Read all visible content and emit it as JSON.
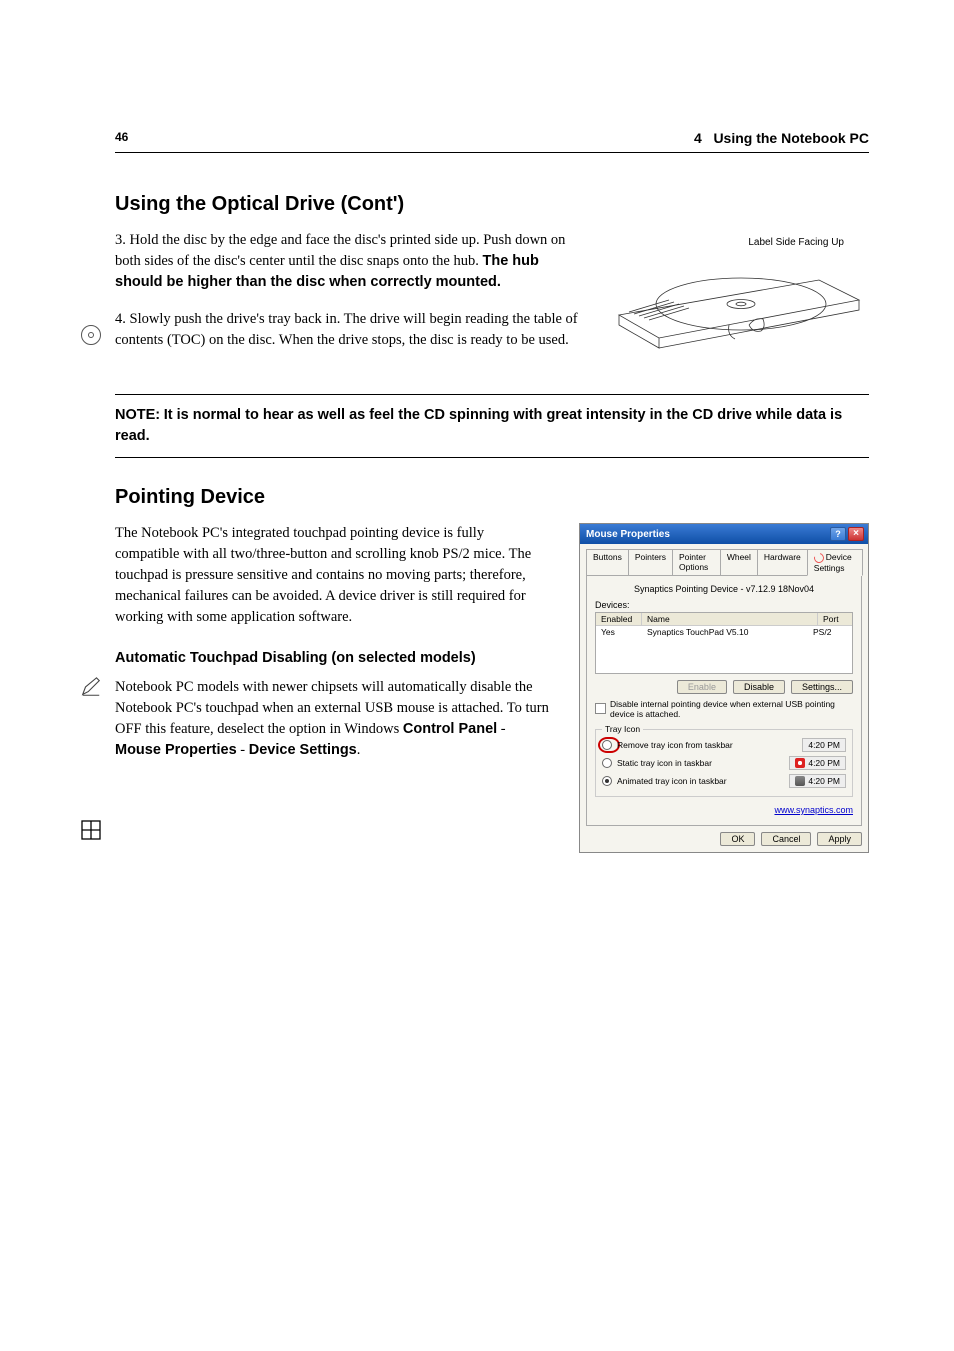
{
  "header": {
    "page_number": "46",
    "chapter_label": "4",
    "chapter_title": "Using the Notebook PC"
  },
  "section1": {
    "title": "Using the Optical Drive (Cont')",
    "p1": "3. Hold the disc by the edge and face the disc's printed side up. Push down on both sides of the disc's center until the disc snaps onto the hub. ",
    "p1_bold": "The hub should be higher than the disc when correctly mounted.",
    "p2": "4. Slowly push the drive's tray back in. The drive will begin reading the table of contents (TOC) on the disc. When the drive stops, the disc is ready to be used.",
    "label_side": "Label Side Facing Up",
    "note_bold": "NOTE:",
    "note_text": " It is normal to hear as well as feel the CD spinning with great intensity in the CD drive while data is read."
  },
  "section2": {
    "title": "Pointing Device",
    "body": "The Notebook PC's integrated touchpad pointing device is fully compatible with all two/three-button and scrolling knob PS/2 mice. The touchpad is pressure sensitive and contains no moving parts; therefore, mechanical failures can be avoided. A device driver is still required for working with some application software.",
    "auto_disable_label": "Automatic Touchpad Disabling (on selected models)",
    "p1": "Notebook PC models with newer chipsets will automatically disable the Notebook PC's touchpad when an external USB mouse is attached. To turn OFF this feature, deselect the option in Windows ",
    "p1_bold1": "Control Panel",
    "p1_sep1": " - ",
    "p1_bold2": "Mouse Properties",
    "p1_sep2": " - ",
    "p1_bold3": "Device Settings",
    "p1_end": "."
  },
  "screenshot": {
    "title": "Mouse Properties",
    "tabs": [
      "Buttons",
      "Pointers",
      "Pointer Options",
      "Wheel",
      "Hardware",
      "Device Settings"
    ],
    "version_line": "Synaptics Pointing Device - v7.12.9 18Nov04",
    "devices_label": "Devices:",
    "cols": {
      "enabled": "Enabled",
      "name": "Name",
      "port": "Port"
    },
    "row": {
      "enabled": "Yes",
      "name": "Synaptics TouchPad V5.10",
      "port": "PS/2"
    },
    "btn_enable": "Enable",
    "btn_disable": "Disable",
    "btn_settings": "Settings...",
    "checkbox_text": "Disable internal pointing device when external USB pointing device is attached.",
    "tray_legend": "Tray Icon",
    "radio1": "Remove tray icon from taskbar",
    "radio2": "Static tray icon in taskbar",
    "radio3": "Animated tray icon in taskbar",
    "time1": "4:20 PM",
    "time2": "4:20 PM",
    "time3": "4:20 PM",
    "link": "www.synaptics.com",
    "ok": "OK",
    "cancel": "Cancel",
    "apply": "Apply"
  }
}
